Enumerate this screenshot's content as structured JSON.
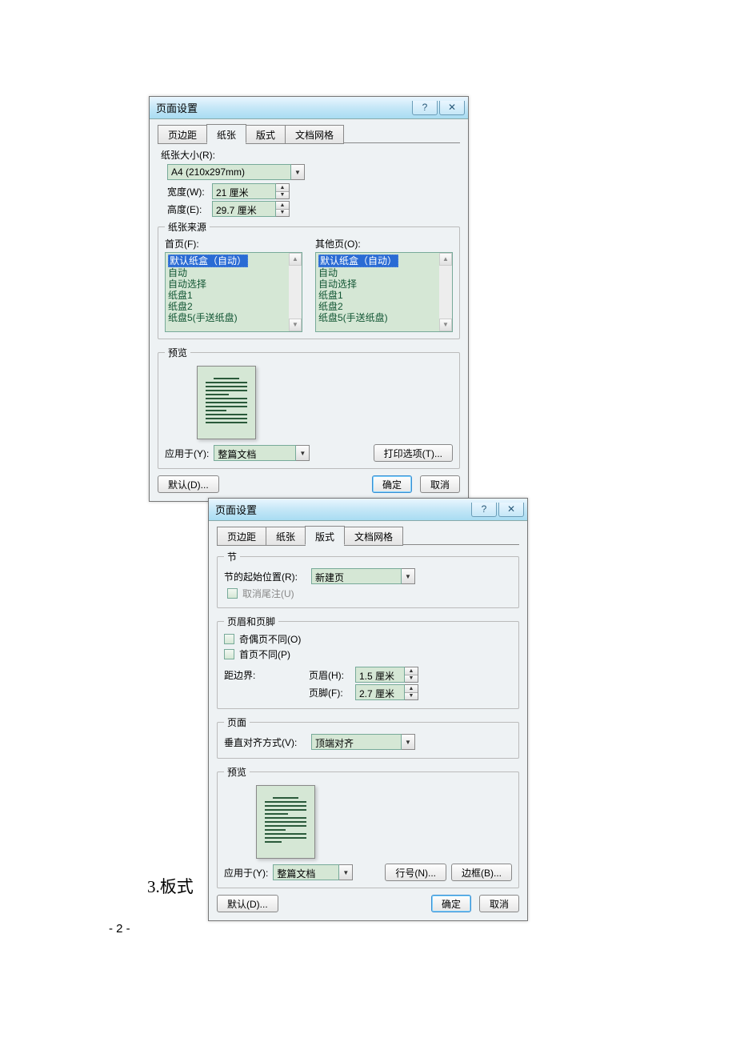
{
  "section_heading": "3.板式",
  "page_footer": "- 2 -",
  "dialog1": {
    "title": "页面设置",
    "tabs": [
      "页边距",
      "纸张",
      "版式",
      "文档网格"
    ],
    "active_tab_index": 1,
    "paper_size_label": "纸张大小(R):",
    "paper_size_value": "A4 (210x297mm)",
    "width_label": "宽度(W):",
    "width_value": "21 厘米",
    "height_label": "高度(E):",
    "height_value": "29.7 厘米",
    "paper_source_legend": "纸张来源",
    "first_page_label": "首页(F):",
    "other_pages_label": "其他页(O):",
    "tray_options": [
      "默认纸盒（自动）",
      "自动",
      "自动选择",
      "纸盘1",
      "纸盘2",
      "纸盘5(手送纸盘)"
    ],
    "preview_legend": "预览",
    "apply_to_label": "应用于(Y):",
    "apply_to_value": "整篇文档",
    "print_options_btn": "打印选项(T)...",
    "default_btn": "默认(D)...",
    "ok_btn": "确定",
    "cancel_btn": "取消"
  },
  "dialog2": {
    "title": "页面设置",
    "tabs": [
      "页边距",
      "纸张",
      "版式",
      "文档网格"
    ],
    "active_tab_index": 2,
    "section_legend": "节",
    "section_start_label": "节的起始位置(R):",
    "section_start_value": "新建页",
    "suppress_endnotes_label": "取消尾注(U)",
    "hf_legend": "页眉和页脚",
    "diff_odd_even_label": "奇偶页不同(O)",
    "diff_first_page_label": "首页不同(P)",
    "from_edge_label": "距边界:",
    "header_label": "页眉(H):",
    "header_value": "1.5 厘米",
    "footer_label": "页脚(F):",
    "footer_value": "2.7 厘米",
    "page_legend": "页面",
    "valign_label": "垂直对齐方式(V):",
    "valign_value": "顶端对齐",
    "preview_legend": "预览",
    "apply_to_label": "应用于(Y):",
    "apply_to_value": "整篇文档",
    "line_numbers_btn": "行号(N)...",
    "borders_btn": "边框(B)...",
    "default_btn": "默认(D)...",
    "ok_btn": "确定",
    "cancel_btn": "取消"
  }
}
